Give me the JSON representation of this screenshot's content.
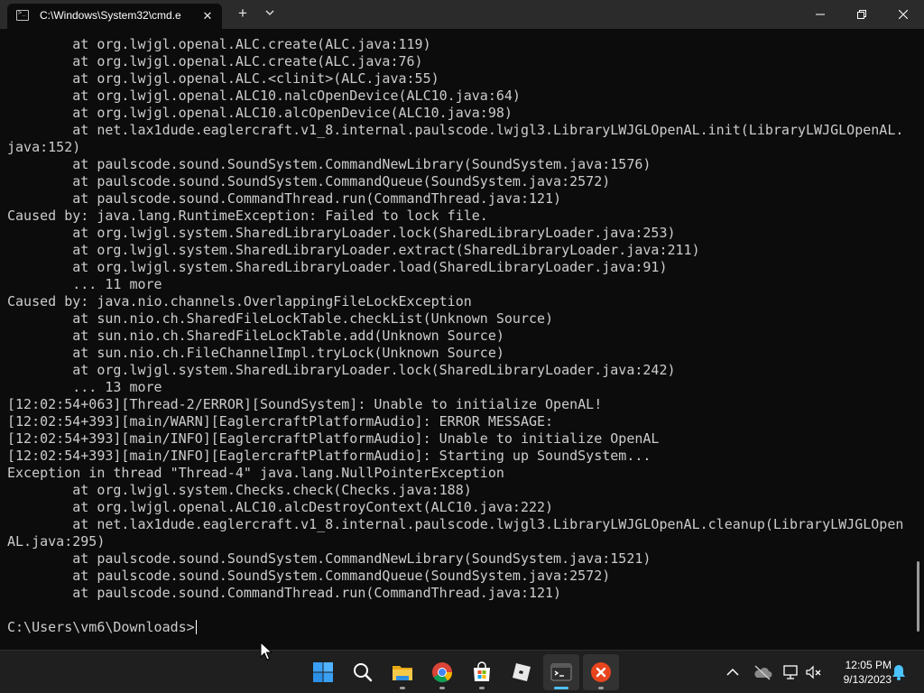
{
  "window": {
    "tab_title": "C:\\Windows\\System32\\cmd.e",
    "tab_close_glyph": "✕",
    "new_tab_glyph": "+"
  },
  "terminal": {
    "lines": [
      "        at org.lwjgl.openal.ALC.create(ALC.java:119)",
      "        at org.lwjgl.openal.ALC.create(ALC.java:76)",
      "        at org.lwjgl.openal.ALC.<clinit>(ALC.java:55)",
      "        at org.lwjgl.openal.ALC10.nalcOpenDevice(ALC10.java:64)",
      "        at org.lwjgl.openal.ALC10.alcOpenDevice(ALC10.java:98)",
      "        at net.lax1dude.eaglercraft.v1_8.internal.paulscode.lwjgl3.LibraryLWJGLOpenAL.init(LibraryLWJGLOpenAL.",
      "java:152)",
      "        at paulscode.sound.SoundSystem.CommandNewLibrary(SoundSystem.java:1576)",
      "        at paulscode.sound.SoundSystem.CommandQueue(SoundSystem.java:2572)",
      "        at paulscode.sound.CommandThread.run(CommandThread.java:121)",
      "Caused by: java.lang.RuntimeException: Failed to lock file.",
      "        at org.lwjgl.system.SharedLibraryLoader.lock(SharedLibraryLoader.java:253)",
      "        at org.lwjgl.system.SharedLibraryLoader.extract(SharedLibraryLoader.java:211)",
      "        at org.lwjgl.system.SharedLibraryLoader.load(SharedLibraryLoader.java:91)",
      "        ... 11 more",
      "Caused by: java.nio.channels.OverlappingFileLockException",
      "        at sun.nio.ch.SharedFileLockTable.checkList(Unknown Source)",
      "        at sun.nio.ch.SharedFileLockTable.add(Unknown Source)",
      "        at sun.nio.ch.FileChannelImpl.tryLock(Unknown Source)",
      "        at org.lwjgl.system.SharedLibraryLoader.lock(SharedLibraryLoader.java:242)",
      "        ... 13 more",
      "[12:02:54+063][Thread-2/ERROR][SoundSystem]: Unable to initialize OpenAL!",
      "[12:02:54+393][main/WARN][EaglercraftPlatformAudio]: ERROR MESSAGE:",
      "[12:02:54+393][main/INFO][EaglercraftPlatformAudio]: Unable to initialize OpenAL",
      "[12:02:54+393][main/INFO][EaglercraftPlatformAudio]: Starting up SoundSystem...",
      "Exception in thread \"Thread-4\" java.lang.NullPointerException",
      "        at org.lwjgl.system.Checks.check(Checks.java:188)",
      "        at org.lwjgl.openal.ALC10.alcDestroyContext(ALC10.java:222)",
      "        at net.lax1dude.eaglercraft.v1_8.internal.paulscode.lwjgl3.LibraryLWJGLOpenAL.cleanup(LibraryLWJGLOpen",
      "AL.java:295)",
      "        at paulscode.sound.SoundSystem.CommandNewLibrary(SoundSystem.java:1521)",
      "        at paulscode.sound.SoundSystem.CommandQueue(SoundSystem.java:2572)",
      "        at paulscode.sound.CommandThread.run(CommandThread.java:121)",
      ""
    ],
    "prompt": "C:\\Users\\vm6\\Downloads>",
    "text_color": "#cccccc",
    "background": "#0c0c0c"
  },
  "taskbar": {
    "apps": [
      {
        "icon": "windows-start-icon",
        "active": false,
        "running": false
      },
      {
        "icon": "search-icon",
        "active": false,
        "running": false
      },
      {
        "icon": "file-explorer-icon",
        "active": false,
        "running": true
      },
      {
        "icon": "chrome-icon",
        "active": false,
        "running": true
      },
      {
        "icon": "microsoft-store-icon",
        "active": false,
        "running": true
      },
      {
        "icon": "roblox-icon",
        "active": false,
        "running": false
      },
      {
        "icon": "terminal-icon",
        "active": true,
        "running": true
      },
      {
        "icon": "red-x-app-icon",
        "active": false,
        "running": true
      }
    ],
    "clock": {
      "time": "12:05 PM",
      "date": "9/13/2023"
    },
    "accent_color": "#4cc2ff"
  }
}
